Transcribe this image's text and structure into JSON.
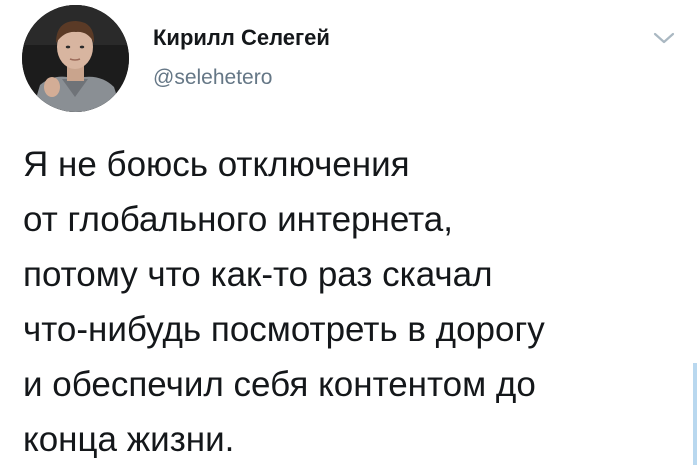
{
  "author": {
    "name": "Кирилл Селегей",
    "handle": "@selehetero",
    "avatar_icon": "profile-photo"
  },
  "menu": {
    "icon": "chevron-down-icon",
    "color": "#aab8c2"
  },
  "tweet": {
    "lines": [
      "Я не боюсь отключения",
      "от глобального интернета,",
      "потому что как-то раз скачал",
      "что-нибудь посмотреть в дорогу",
      "и обеспечил себя контентом до",
      "конца жизни."
    ]
  },
  "colors": {
    "text": "#14171a",
    "secondary": "#657786"
  }
}
